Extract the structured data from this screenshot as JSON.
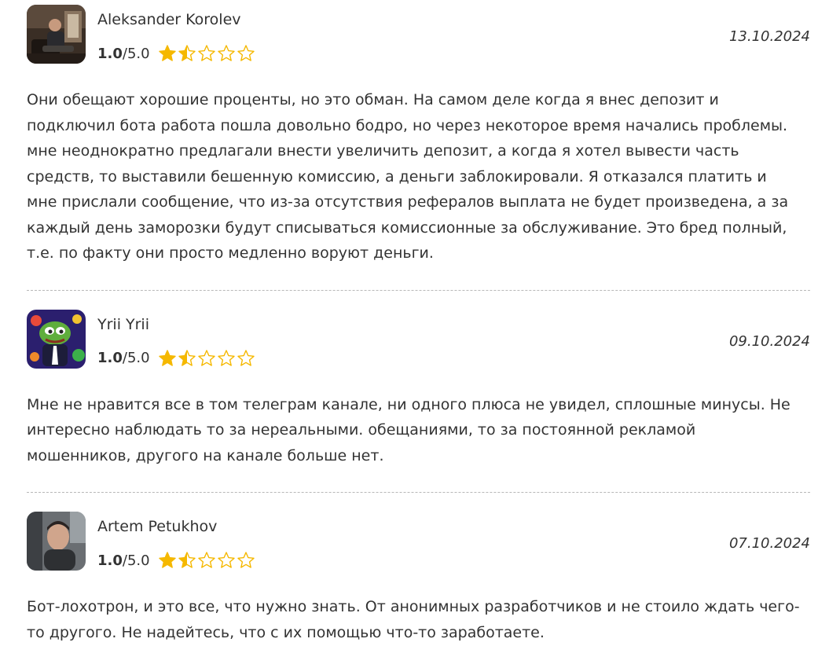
{
  "reviews": [
    {
      "author": "Aleksander Korolev",
      "score": "1.0",
      "max": "/5.0",
      "stars_filled": 1.5,
      "date": "13.10.2024",
      "text": "Они обещают хорошие проценты, но это обман. На самом деле когда я внес депозит и подключил бота работа пошла довольно бодро, но через некоторое время начались проблемы. мне неоднократно предлагали внести увеличить депозит, а когда я хотел вывести часть средств, то выставили бешенную комиссию, а деньги заблокировали. Я отказался платить и мне прислали сообщение, что из-за отсутствия рефералов выплата не будет произведена, а за каждый день заморозки будут списываться комиссионные за обслуживание. Это бред полный, т.е. по факту они просто медленно воруют деньги."
    },
    {
      "author": "Yrii Yrii",
      "score": "1.0",
      "max": "/5.0",
      "stars_filled": 1.5,
      "date": "09.10.2024",
      "text": "Мне не нравится все в том телеграм канале, ни одного плюса не увидел, сплошные минусы. Не интересно наблюдать то за нереальными. обещаниями, то за постоянной рекламой мошенников, другого на канале больше нет."
    },
    {
      "author": "Artem Petukhov",
      "score": "1.0",
      "max": "/5.0",
      "stars_filled": 1.5,
      "date": "07.10.2024",
      "text": "Бот-лохотрон, и это все, что нужно знать. От анонимных разработчиков и не стоило ждать чего-то другого. Не надейтесь, что с их помощью что-то заработаете."
    }
  ],
  "colors": {
    "star": "#f5b800",
    "text": "#333333",
    "divider": "#b8b8b8"
  }
}
